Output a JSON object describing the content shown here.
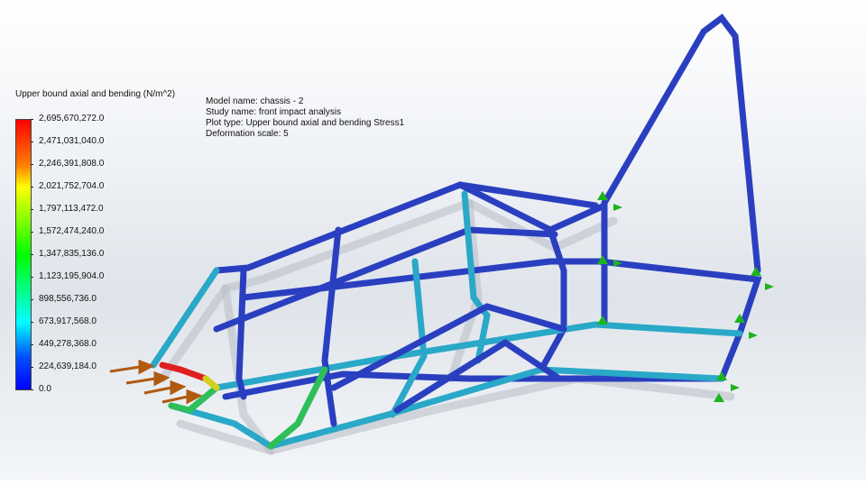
{
  "legend": {
    "title": "Upper bound axial and bending (N/m^2)",
    "labels": [
      "2,695,670,272.0",
      "2,471,031,040.0",
      "2,246,391,808.0",
      "2,021,752,704.0",
      "1,797,113,472.0",
      "1,572,474,240.0",
      "1,347,835,136.0",
      "1,123,195,904.0",
      "898,556,736.0",
      "673,917,568.0",
      "449,278,368.0",
      "224,639,184.0",
      "0.0"
    ],
    "max_color": "#ff0000",
    "min_color": "#0000ff"
  },
  "info": {
    "model": "Model name: chassis - 2",
    "study": "Study name: front impact analysis",
    "plot": "Plot type: Upper bound axial and bending Stress1",
    "deformation": "Deformation scale: 5"
  },
  "colors": {
    "tube": "#2a3fc0",
    "tube_mid": "#2aa8c8",
    "tube_high": "#2fbf5a",
    "load_arrow": "#b05a10",
    "fixture": "#1db31d"
  }
}
